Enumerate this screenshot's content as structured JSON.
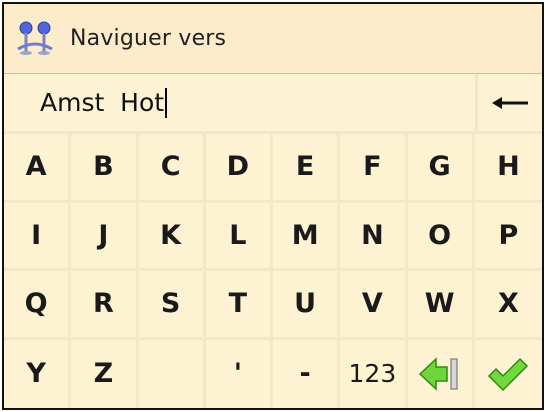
{
  "title": "Naviguer vers",
  "input": {
    "value": "Amst  Hot"
  },
  "keys_letters": [
    [
      "A",
      "B",
      "C",
      "D",
      "E",
      "F",
      "G",
      "H"
    ],
    [
      "I",
      "J",
      "K",
      "L",
      "M",
      "N",
      "O",
      "P"
    ],
    [
      "Q",
      "R",
      "S",
      "T",
      "U",
      "V",
      "W",
      "X"
    ]
  ],
  "keys_bottom": {
    "y": "Y",
    "z": "Z",
    "apostrophe": "'",
    "dash": "-",
    "numbers": "123"
  },
  "icons": {
    "title": "navigation-pins-icon",
    "backspace": "backspace-arrow-icon",
    "keyboard_toggle": "green-arrow-bar-icon",
    "confirm": "green-checkmark-icon"
  },
  "colors": {
    "key_bg": "#fdf2d2",
    "title_bg": "#fdeccb",
    "accent_green": "#5fcc2c"
  }
}
